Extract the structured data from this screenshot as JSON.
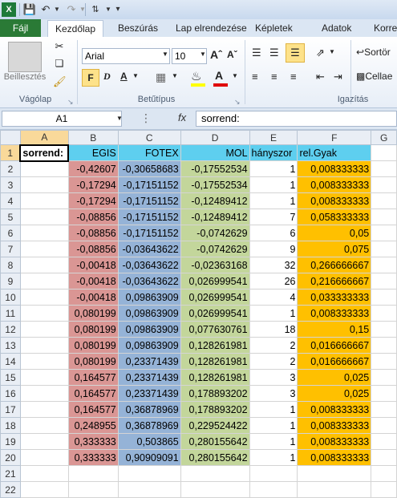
{
  "ribbon": {
    "tabs": [
      "Fájl",
      "Kezdőlap",
      "Beszúrás",
      "Lap elrendezése",
      "Képletek",
      "Adatok",
      "Korre"
    ],
    "paste_label": "Beillesztés",
    "clipboard_label": "Vágólap",
    "font_label": "Betűtípus",
    "align_label": "Igazítás",
    "font_name": "Arial",
    "font_size": "10",
    "sort_label": "Sortör",
    "merge_label": "Cellae"
  },
  "formula_bar": {
    "name_box": "A1",
    "fx": "fx",
    "formula": "sorrend:"
  },
  "sheet": {
    "columns": [
      "A",
      "B",
      "C",
      "D",
      "E",
      "F",
      "G"
    ],
    "header_row": [
      "sorrend:",
      "EGIS",
      "FOTEX",
      "MOL",
      "hányszor",
      "rel.Gyak",
      ""
    ],
    "rows": [
      [
        "2",
        "-0,42607",
        "-0,30658683",
        "-0,17552534",
        "1",
        "0,008333333"
      ],
      [
        "3",
        "-0,17294",
        "-0,17151152",
        "-0,17552534",
        "1",
        "0,008333333"
      ],
      [
        "4",
        "-0,17294",
        "-0,17151152",
        "-0,12489412",
        "1",
        "0,008333333"
      ],
      [
        "5",
        "-0,08856",
        "-0,17151152",
        "-0,12489412",
        "7",
        "0,058333333"
      ],
      [
        "6",
        "-0,08856",
        "-0,17151152",
        "-0,0742629",
        "6",
        "0,05"
      ],
      [
        "7",
        "-0,08856",
        "-0,03643622",
        "-0,0742629",
        "9",
        "0,075"
      ],
      [
        "8",
        "-0,00418",
        "-0,03643622",
        "-0,02363168",
        "32",
        "0,266666667"
      ],
      [
        "9",
        "-0,00418",
        "-0,03643622",
        "0,026999541",
        "26",
        "0,216666667"
      ],
      [
        "10",
        "-0,00418",
        "0,09863909",
        "0,026999541",
        "4",
        "0,033333333"
      ],
      [
        "11",
        "0,080199",
        "0,09863909",
        "0,026999541",
        "1",
        "0,008333333"
      ],
      [
        "12",
        "0,080199",
        "0,09863909",
        "0,077630761",
        "18",
        "0,15"
      ],
      [
        "13",
        "0,080199",
        "0,09863909",
        "0,128261981",
        "2",
        "0,016666667"
      ],
      [
        "14",
        "0,080199",
        "0,23371439",
        "0,128261981",
        "2",
        "0,016666667"
      ],
      [
        "15",
        "0,164577",
        "0,23371439",
        "0,128261981",
        "3",
        "0,025"
      ],
      [
        "16",
        "0,164577",
        "0,23371439",
        "0,178893202",
        "3",
        "0,025"
      ],
      [
        "17",
        "0,164577",
        "0,36878969",
        "0,178893202",
        "1",
        "0,008333333"
      ],
      [
        "18",
        "0,248955",
        "0,36878969",
        "0,229524422",
        "1",
        "0,008333333"
      ],
      [
        "19",
        "0,333333",
        "0,503865",
        "0,280155642",
        "1",
        "0,008333333"
      ],
      [
        "20",
        "0,333333",
        "0,90909091",
        "0,280155642",
        "1",
        "0,008333333"
      ]
    ],
    "empty_rows": [
      "21",
      "22"
    ]
  }
}
